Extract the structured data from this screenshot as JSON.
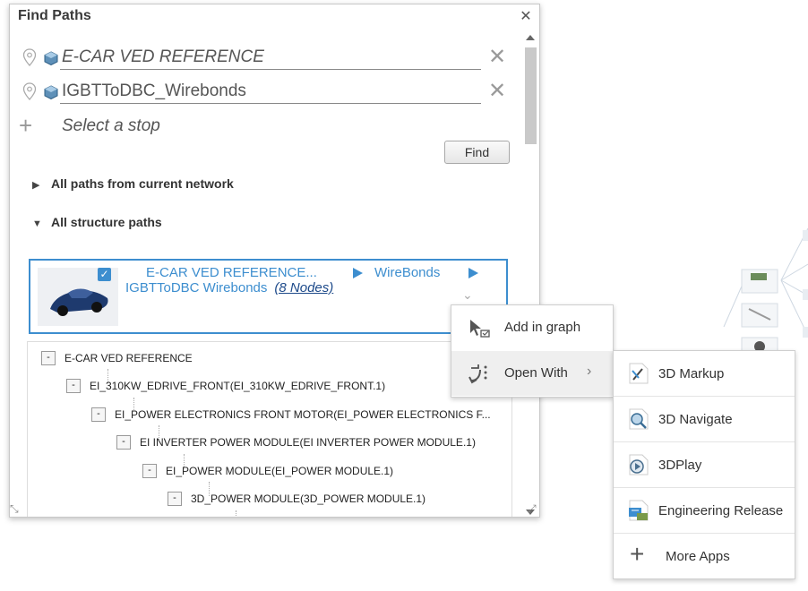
{
  "panel": {
    "title": "Find Paths"
  },
  "stops": [
    {
      "value": "E-CAR VED REFERENCE",
      "italic": true
    },
    {
      "value": "IGBTToDBC_Wirebonds",
      "italic": false
    }
  ],
  "add_stop": {
    "placeholder": "Select a stop"
  },
  "find_button": "Find",
  "sections": [
    {
      "label": "All paths from current network",
      "expanded": false
    },
    {
      "label": "All structure paths",
      "expanded": true
    }
  ],
  "path_card": {
    "start": "E-CAR VED REFERENCE...",
    "mid": "WireBonds",
    "end": "IGBTToDBC  Wirebonds",
    "nodes": "(8 Nodes)",
    "checked": true
  },
  "tree": [
    {
      "label": "E-CAR VED REFERENCE",
      "toggle": "-"
    },
    {
      "label": "EI_310KW_EDRIVE_FRONT(EI_310KW_EDRIVE_FRONT.1)",
      "toggle": "-"
    },
    {
      "label": "EI_POWER ELECTRONICS FRONT MOTOR(EI_POWER ELECTRONICS F...",
      "toggle": "-"
    },
    {
      "label": "EI INVERTER POWER MODULE(EI INVERTER POWER MODULE.1)",
      "toggle": "-"
    },
    {
      "label": "EI_POWER MODULE(EI_POWER MODULE.1)",
      "toggle": "-"
    },
    {
      "label": "3D_POWER MODULE(3D_POWER MODULE.1)",
      "toggle": "-"
    }
  ],
  "context_menu": [
    {
      "label": "Add in graph",
      "icon": "add-in-graph-icon"
    },
    {
      "label": "Open With",
      "icon": "open-with-icon",
      "has_submenu": true
    }
  ],
  "submenu": [
    {
      "label": "3D Markup",
      "icon": "3d-markup-icon"
    },
    {
      "label": "3D Navigate",
      "icon": "3d-navigate-icon"
    },
    {
      "label": "3DPlay",
      "icon": "3dplay-icon"
    },
    {
      "label": "Engineering Release",
      "icon": "engineering-release-icon"
    },
    {
      "label": "More Apps",
      "icon": "plus-icon"
    }
  ],
  "colors": {
    "accent": "#3d8ecf",
    "link": "#1d4a8a",
    "menu_hover": "#efefef"
  }
}
